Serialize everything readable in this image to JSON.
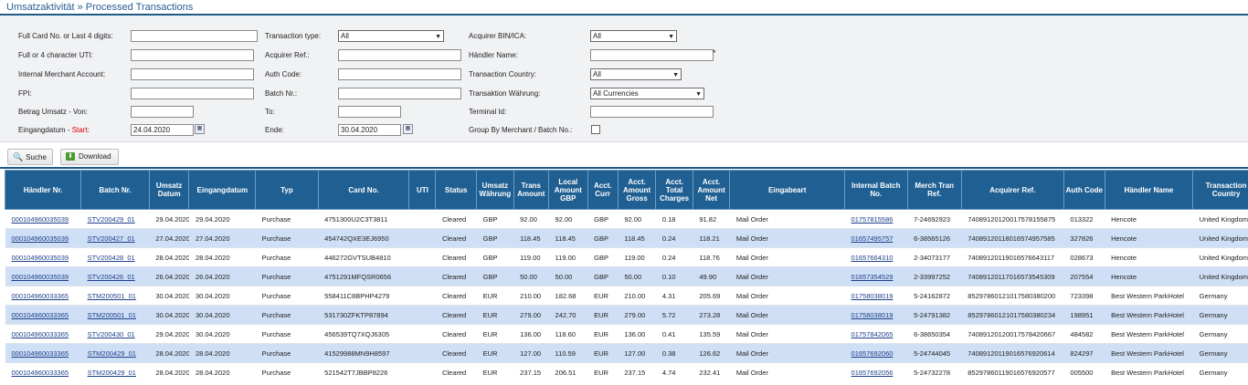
{
  "breadcrumb": "Umsatzaktivität » Processed Transactions",
  "filters": {
    "card_label": "Full Card No. or Last 4 digits:",
    "uti_label": "Full or 4 character UTI:",
    "merchant_label": "Internal Merchant Account:",
    "fpi_label": "FPI:",
    "betrag_label": "Betrag Umsatz - Von:",
    "eingang_label": "Eingangdatum - ",
    "eingang_start": "Start",
    "eingang_after": ":",
    "start_date": "24.04.2020",
    "txtype_label": "Transaction type:",
    "txtype_value": "All",
    "acqref_label": "Acquirer Ref.:",
    "auth_label": "Auth Code:",
    "batch_label": "Batch Nr.:",
    "to_label": "To:",
    "ende_label": "Ende:",
    "end_date": "30.04.2020",
    "bin_label": "Acquirer BIN/ICA:",
    "bin_value": "All",
    "haendler_label": "Händler Name:",
    "haendler_star": "*",
    "country_label": "Transaction Country:",
    "country_value": "All",
    "currency_label": "Transaktion Währung:",
    "currency_value": "All Currencies",
    "terminal_label": "Terminal Id:",
    "group_label": "Group By Merchant / Batch No.:"
  },
  "buttons": {
    "search": "Suche",
    "download": "Download"
  },
  "table": {
    "headers": [
      "Händler Nr.",
      "Batch Nr.",
      "Umsatz Datum",
      "Eingangdatum",
      "Typ",
      "Card No.",
      "UTI",
      "Status",
      "Umsatz Währung",
      "Trans Amount",
      "Local Amount GBP",
      "Acct. Curr",
      "Acct. Amount Gross",
      "Acct. Total Charges",
      "Acct. Amount Net",
      "Eingabeart",
      "Internal Batch No.",
      "Merch Tran Ref.",
      "Acquirer Ref.",
      "Auth Code",
      "Händler Name",
      "Transaction Country"
    ],
    "rows": [
      [
        "000104960035039",
        "STV200429_01",
        "29.04.2020",
        "29.04.2020",
        "Purchase",
        "4751300U2C3T3811",
        "",
        "Cleared",
        "GBP",
        "92.00",
        "92.00",
        "GBP",
        "92.00",
        "0.18",
        "91.82",
        "Mail Order",
        "01757815586",
        "7-24692923",
        "74089120120017578155875",
        "013322",
        "Hencote",
        "United Kingdom"
      ],
      [
        "000104960035039",
        "STV200427_01",
        "27.04.2020",
        "27.04.2020",
        "Purchase",
        "454742QXE3EJ6950",
        "",
        "Cleared",
        "GBP",
        "118.45",
        "118.45",
        "GBP",
        "118.45",
        "0.24",
        "118.21",
        "Mail Order",
        "01657495757",
        "6-38565126",
        "74089120118016574957585",
        "327826",
        "Hencote",
        "United Kingdom"
      ],
      [
        "000104960035039",
        "STV200428_01",
        "28.04.2020",
        "28.04.2020",
        "Purchase",
        "446272GVTSUB4810",
        "",
        "Cleared",
        "GBP",
        "119.00",
        "119.00",
        "GBP",
        "119.00",
        "0.24",
        "118.76",
        "Mail Order",
        "01657664310",
        "2-34073177",
        "74089120119016576643117",
        "028673",
        "Hencote",
        "United Kingdom"
      ],
      [
        "000104960035039",
        "STV200426_01",
        "26.04.2020",
        "26.04.2020",
        "Purchase",
        "4751291MFQSR0656",
        "",
        "Cleared",
        "GBP",
        "50.00",
        "50.00",
        "GBP",
        "50.00",
        "0.10",
        "49.90",
        "Mail Order",
        "01657354529",
        "2-33997252",
        "74089120117016573545309",
        "207554",
        "Hencote",
        "United Kingdom"
      ],
      [
        "000104960033365",
        "STM200501_01",
        "30.04.2020",
        "30.04.2020",
        "Purchase",
        "558411C8BPHP4279",
        "",
        "Cleared",
        "EUR",
        "210.00",
        "182.68",
        "EUR",
        "210.00",
        "4.31",
        "205.69",
        "Mail Order",
        "01758038019",
        "5-24162872",
        "85297860121017580380200",
        "723398",
        "Best Western ParkHotel",
        "Germany"
      ],
      [
        "000104960033365",
        "STM200501_01",
        "30.04.2020",
        "30.04.2020",
        "Purchase",
        "531730ZFKTP87894",
        "",
        "Cleared",
        "EUR",
        "279.00",
        "242.70",
        "EUR",
        "279.00",
        "5.72",
        "273.28",
        "Mail Order",
        "01758038019",
        "5-24791382",
        "85297860121017580380234",
        "198951",
        "Best Western ParkHotel",
        "Germany"
      ],
      [
        "000104960033365",
        "STV200430_01",
        "29.04.2020",
        "30.04.2020",
        "Purchase",
        "456539TQ7XQJ6305",
        "",
        "Cleared",
        "EUR",
        "136.00",
        "118.60",
        "EUR",
        "136.00",
        "0.41",
        "135.59",
        "Mail Order",
        "01757842065",
        "6-38650354",
        "74089120120017578420667",
        "484582",
        "Best Western ParkHotel",
        "Germany"
      ],
      [
        "000104960033365",
        "STM200429_01",
        "28.04.2020",
        "28.04.2020",
        "Purchase",
        "41529988MN9H8597",
        "",
        "Cleared",
        "EUR",
        "127.00",
        "110.59",
        "EUR",
        "127.00",
        "0.38",
        "126.62",
        "Mail Order",
        "01657692060",
        "5-24744045",
        "74089120119016576920614",
        "824297",
        "Best Western ParkHotel",
        "Germany"
      ],
      [
        "000104960033365",
        "STM200429_01",
        "28.04.2020",
        "28.04.2020",
        "Purchase",
        "521542T7JBBP8226",
        "",
        "Cleared",
        "EUR",
        "237.15",
        "206.51",
        "EUR",
        "237.15",
        "4.74",
        "232.41",
        "Mail Order",
        "01657692056",
        "5-24732278",
        "85297860119016576920577",
        "005500",
        "Best Western ParkHotel",
        "Germany"
      ]
    ]
  }
}
